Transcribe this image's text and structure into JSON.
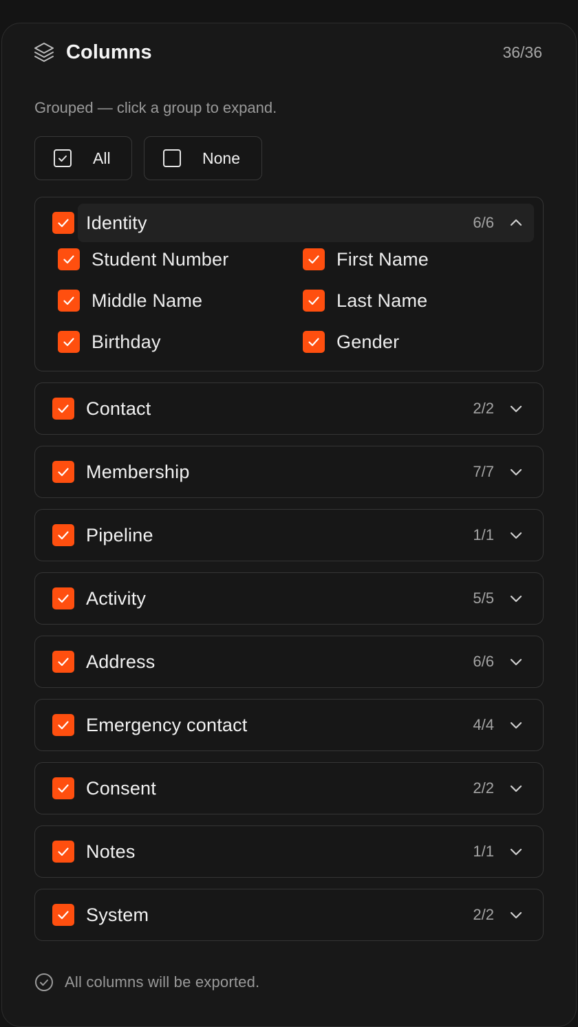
{
  "header": {
    "title": "Columns",
    "total": "36/36"
  },
  "subtitle": "Grouped — click a group to expand.",
  "actions": {
    "all_label": "All",
    "none_label": "None"
  },
  "accent_color": "#ff4f0f",
  "groups": [
    {
      "name": "Identity",
      "count": "6/6",
      "expanded": true,
      "items": [
        "Student Number",
        "First Name",
        "Middle Name",
        "Last Name",
        "Birthday",
        "Gender"
      ]
    },
    {
      "name": "Contact",
      "count": "2/2"
    },
    {
      "name": "Membership",
      "count": "7/7"
    },
    {
      "name": "Pipeline",
      "count": "1/1"
    },
    {
      "name": "Activity",
      "count": "5/5"
    },
    {
      "name": "Address",
      "count": "6/6"
    },
    {
      "name": "Emergency contact",
      "count": "4/4"
    },
    {
      "name": "Consent",
      "count": "2/2"
    },
    {
      "name": "Notes",
      "count": "1/1"
    },
    {
      "name": "System",
      "count": "2/2"
    }
  ],
  "footer": {
    "message": "All columns will be exported."
  }
}
